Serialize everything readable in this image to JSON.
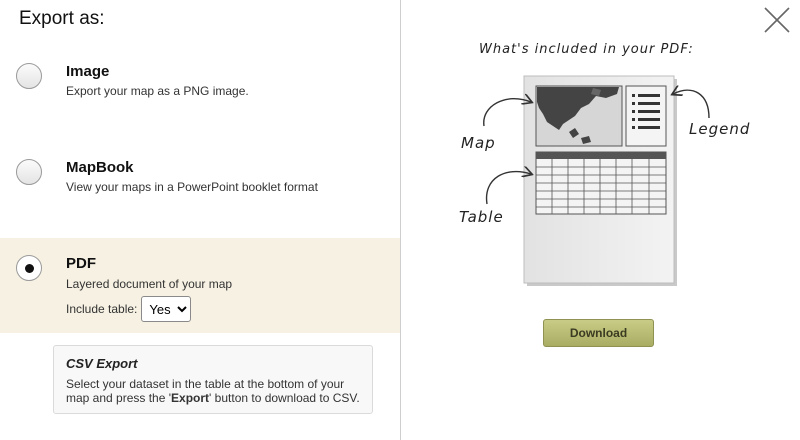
{
  "dialog": {
    "title": "Export as:",
    "options": [
      {
        "id": "image",
        "label": "Image",
        "description": "Export your map as a PNG image.",
        "selected": false
      },
      {
        "id": "mapbook",
        "label": "MapBook",
        "description": "View your maps in a PowerPoint booklet format",
        "selected": false
      },
      {
        "id": "pdf",
        "label": "PDF",
        "description": "Layered document of your map",
        "selected": true
      }
    ],
    "include_table": {
      "label": "Include table:",
      "value": "Yes",
      "options": [
        "Yes"
      ]
    },
    "csv_export": {
      "title": "CSV Export",
      "text_before": "Select your dataset in the table at the bottom of your map and press the '",
      "bold": "Export",
      "text_after": "' button to download to CSV."
    }
  },
  "preview": {
    "heading": "What's included in your PDF:",
    "labels": {
      "map": "Map",
      "legend": "Legend",
      "table": "Table"
    },
    "download_label": "Download",
    "close_icon": "close-icon"
  },
  "colors": {
    "selected_bg": "#f6f1e2",
    "download_bg": "#b8bb72",
    "map_land": "#444444",
    "map_water": "#d6d6d6"
  }
}
